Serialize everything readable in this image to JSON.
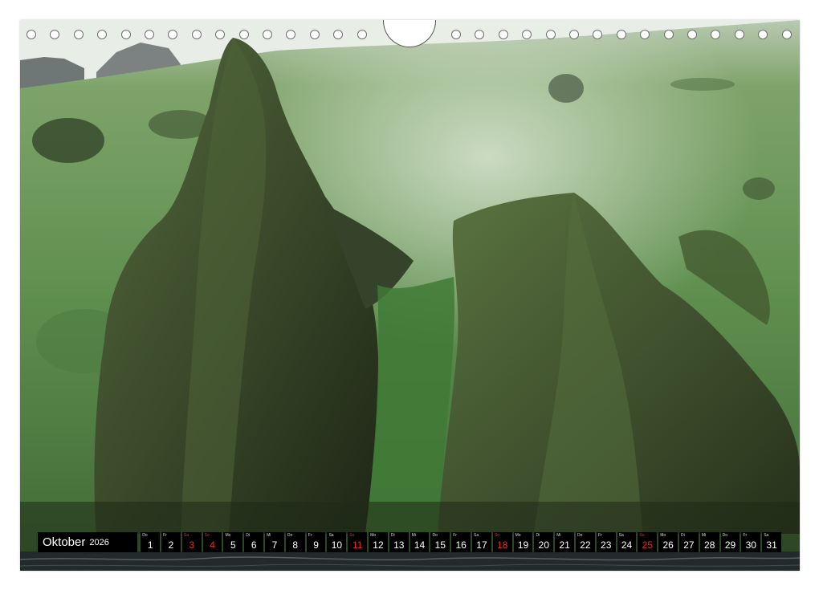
{
  "calendar": {
    "month": "Oktober",
    "year": "2026",
    "days": [
      {
        "wd": "Do",
        "n": "1",
        "red": false
      },
      {
        "wd": "Fr",
        "n": "2",
        "red": false
      },
      {
        "wd": "Sa",
        "n": "3",
        "red": true
      },
      {
        "wd": "So",
        "n": "4",
        "red": true
      },
      {
        "wd": "Mo",
        "n": "5",
        "red": false
      },
      {
        "wd": "Di",
        "n": "6",
        "red": false
      },
      {
        "wd": "Mi",
        "n": "7",
        "red": false
      },
      {
        "wd": "Do",
        "n": "8",
        "red": false
      },
      {
        "wd": "Fr",
        "n": "9",
        "red": false
      },
      {
        "wd": "Sa",
        "n": "10",
        "red": false
      },
      {
        "wd": "So",
        "n": "11",
        "red": true
      },
      {
        "wd": "Mo",
        "n": "12",
        "red": false
      },
      {
        "wd": "Di",
        "n": "13",
        "red": false
      },
      {
        "wd": "Mi",
        "n": "14",
        "red": false
      },
      {
        "wd": "Do",
        "n": "15",
        "red": false
      },
      {
        "wd": "Fr",
        "n": "16",
        "red": false
      },
      {
        "wd": "Sa",
        "n": "17",
        "red": false
      },
      {
        "wd": "So",
        "n": "18",
        "red": true
      },
      {
        "wd": "Mo",
        "n": "19",
        "red": false
      },
      {
        "wd": "Di",
        "n": "20",
        "red": false
      },
      {
        "wd": "Mi",
        "n": "21",
        "red": false
      },
      {
        "wd": "Do",
        "n": "22",
        "red": false
      },
      {
        "wd": "Fr",
        "n": "23",
        "red": false
      },
      {
        "wd": "Sa",
        "n": "24",
        "red": false
      },
      {
        "wd": "So",
        "n": "25",
        "red": true
      },
      {
        "wd": "Mo",
        "n": "26",
        "red": false
      },
      {
        "wd": "Di",
        "n": "27",
        "red": false
      },
      {
        "wd": "Mi",
        "n": "28",
        "red": false
      },
      {
        "wd": "Do",
        "n": "29",
        "red": false
      },
      {
        "wd": "Fr",
        "n": "30",
        "red": false
      },
      {
        "wd": "Sa",
        "n": "31",
        "red": false
      }
    ]
  },
  "colors": {
    "grass": "#5f8f4f",
    "moss_dark": "#2c3a22",
    "sky": "#e9ede8",
    "water": "#232a2c",
    "holiday": "#e03030"
  }
}
